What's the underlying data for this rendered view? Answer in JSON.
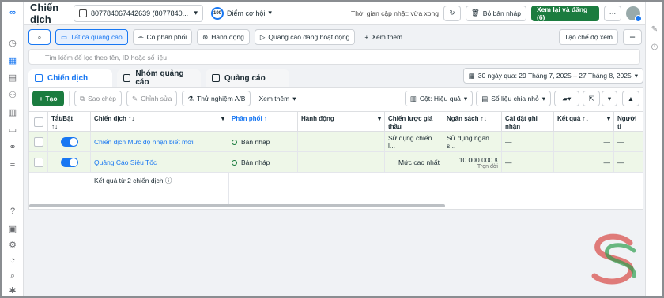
{
  "topbar": {
    "title": "Chiến dịch",
    "account": "807784067442639 (8077840...",
    "opportunity_score": "100",
    "opportunity_label": "Điểm cơ hội",
    "updated": "Thời gian cập nhật: vừa xong",
    "discard_label": "Bỏ bản nháp",
    "review_label": "Xem lại và đăng (6)",
    "more": "···"
  },
  "filters": {
    "all_ads": "Tất cả quảng cáo",
    "has_delivery": "Có phân phối",
    "actions": "Hành động",
    "active_ads": "Quảng cáo đang hoạt động",
    "more": "Xem thêm",
    "create_view": "Tạo chế độ xem"
  },
  "search": {
    "placeholder": "Tìm kiếm để lọc theo tên, ID hoặc số liệu"
  },
  "tabs": {
    "campaigns": "Chiến dịch",
    "adsets": "Nhóm quảng cáo",
    "ads": "Quảng cáo",
    "date_range": "30 ngày qua: 29 Tháng 7, 2025 – 27 Tháng 8, 2025"
  },
  "toolbar": {
    "create": "Tạo",
    "copy": "Sao chép",
    "edit": "Chỉnh sửa",
    "ab_test": "Thử nghiệm A/B",
    "more": "Xem thêm",
    "columns": "Cột: Hiệu quả",
    "breakdown": "Số liệu chia nhỏ"
  },
  "table": {
    "headers": {
      "toggle": "Tắt/Bật",
      "campaign": "Chiến dịch",
      "delivery": "Phân phối ↑",
      "actions": "Hành động",
      "bid": "Chiến lược giá thầu",
      "budget": "Ngân sách",
      "attribution": "Cài đặt ghi nhận",
      "results": "Kết quả",
      "reach": "Người ti"
    },
    "rows": [
      {
        "name": "Chiến dịch Mức độ nhận biết mới",
        "delivery": "Bản nháp",
        "bid": "Sử dụng chiến l...",
        "budget": "Sử dụng ngân s...",
        "attribution": "—",
        "results": "—",
        "reach": "—"
      },
      {
        "name": "Quảng Cáo Siêu Tốc",
        "delivery": "Bản nháp",
        "bid": "Mức cao nhất",
        "budget": "10.000.000 ₫",
        "budget_sub": "Trọn đời",
        "attribution": "—",
        "results": "—",
        "reach": "—"
      }
    ],
    "footer": "Kết quả từ 2 chiến dịch"
  }
}
